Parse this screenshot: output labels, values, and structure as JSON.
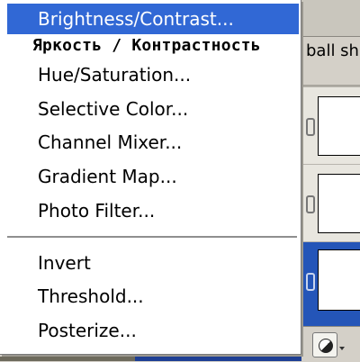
{
  "menu": {
    "items": [
      {
        "label": "Brightness/Contrast..."
      },
      {
        "label": "Hue/Saturation..."
      },
      {
        "label": "Selective Color..."
      },
      {
        "label": "Channel Mixer..."
      },
      {
        "label": "Gradient Map..."
      },
      {
        "label": "Photo Filter..."
      },
      {
        "label": "Invert"
      },
      {
        "label": "Threshold..."
      },
      {
        "label": "Posterize..."
      }
    ],
    "highlighted_item": "Brightness/Contrast..."
  },
  "annotation": {
    "text": "Яркость / Контрастность"
  },
  "background_panel": {
    "partial_label": "ball sh"
  },
  "colors": {
    "highlight": "#3168d5",
    "selected_layer": "#2455b8"
  }
}
